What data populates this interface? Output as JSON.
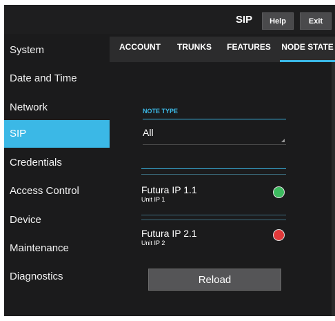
{
  "header": {
    "title": "SIP",
    "help_label": "Help",
    "exit_label": "Exit"
  },
  "sidebar": {
    "items": [
      {
        "label": "System"
      },
      {
        "label": "Date and Time"
      },
      {
        "label": "Network"
      },
      {
        "label": "SIP"
      },
      {
        "label": "Credentials"
      },
      {
        "label": "Access Control"
      },
      {
        "label": "Device"
      },
      {
        "label": "Maintenance"
      },
      {
        "label": "Diagnostics"
      }
    ],
    "active": "SIP"
  },
  "tabs": {
    "items": [
      {
        "label": "ACCOUNT"
      },
      {
        "label": "TRUNKS"
      },
      {
        "label": "FEATURES"
      },
      {
        "label": "NODE STATE"
      }
    ],
    "active": "NODE STATE"
  },
  "main": {
    "note_type_label": "NOTE TYPE",
    "note_type_value": "All",
    "nodes": [
      {
        "name": "Futura IP 1.1",
        "sub": "Unit IP 1",
        "status_color": "#3dbb5f"
      },
      {
        "name": "Futura IP 2.1",
        "sub": "Unit IP 2",
        "status_color": "#e0393a"
      }
    ],
    "reload_label": "Reload"
  },
  "colors": {
    "accent": "#3bb8e6",
    "background": "#1b1b1c",
    "button": "#555557"
  }
}
